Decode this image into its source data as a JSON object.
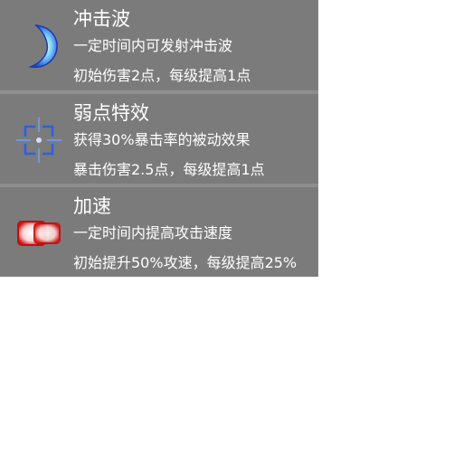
{
  "skills": [
    {
      "name": "冲击波",
      "desc": "一定时间内可发射冲击波",
      "bonus": "初始伤害2点，每级提高1点",
      "icon": "crescent-moon-icon",
      "accent": "#3aa0ff"
    },
    {
      "name": "弱点特效",
      "desc": "获得30%暴击率的被动效果",
      "bonus": "暴击伤害2.5点，每级提高1点",
      "icon": "crosshair-icon",
      "accent": "#3b6fe0"
    },
    {
      "name": "加速",
      "desc": "一定时间内提高攻击速度",
      "bonus": "初始提升50%攻速，每级提高25%",
      "icon": "speed-boost-icon",
      "accent": "#e02020"
    }
  ]
}
